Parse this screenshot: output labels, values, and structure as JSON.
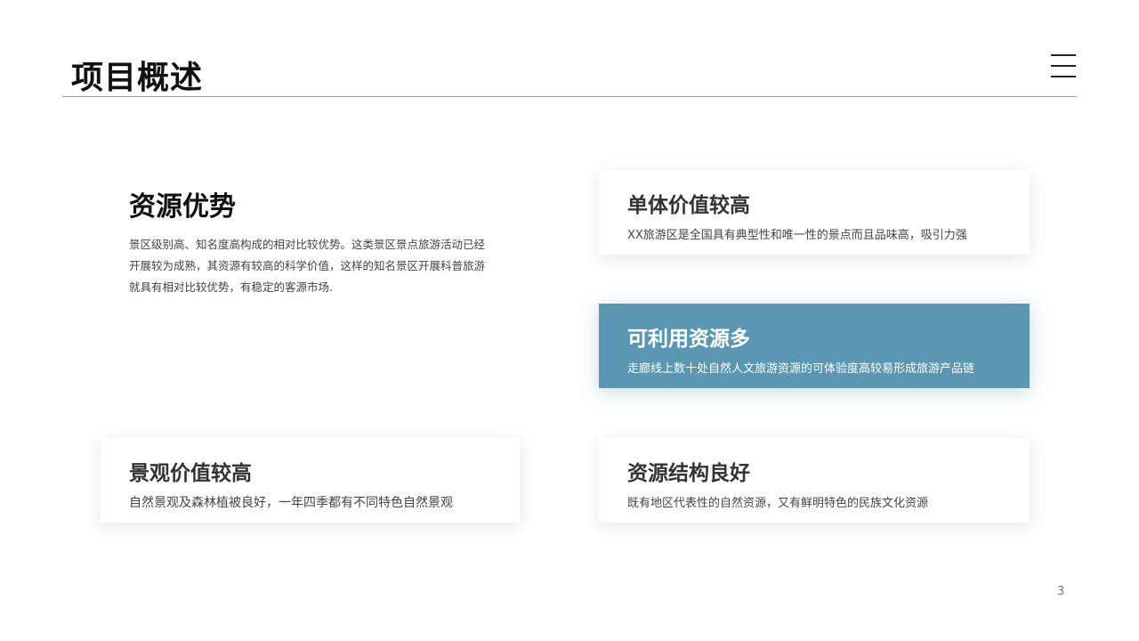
{
  "header": {
    "title": "项目概述",
    "menu_icon": "hamburger-menu-icon"
  },
  "intro": {
    "heading": "资源优势",
    "body": "景区级别高、知名度高构成的相对比较优势。这类景区景点旅游活动已经开展较为成熟，其资源有较高的科学价值，这样的知名景区开展科普旅游就具有相对比较优势，有稳定的客源市场."
  },
  "cards": [
    {
      "title": "单体价值较高",
      "desc": "XX旅游区是全国具有典型性和唯一性的景点而且品味高，吸引力强"
    },
    {
      "title": "可利用资源多",
      "desc": "走廊线上数十处自然人文旅游资源的可体验度高较易形成旅游产品链"
    },
    {
      "title": "景观价值较高",
      "desc": "自然景观及森林植被良好，一年四季都有不同特色自然景观"
    },
    {
      "title": "资源结构良好",
      "desc": "既有地区代表性的自然资源，又有鲜明特色的民族文化资源"
    }
  ],
  "page_number": "3",
  "colors": {
    "accent": "#5b97b3",
    "title_text": "#111111",
    "body_text": "#444444",
    "rule": "#9a9a9a"
  }
}
